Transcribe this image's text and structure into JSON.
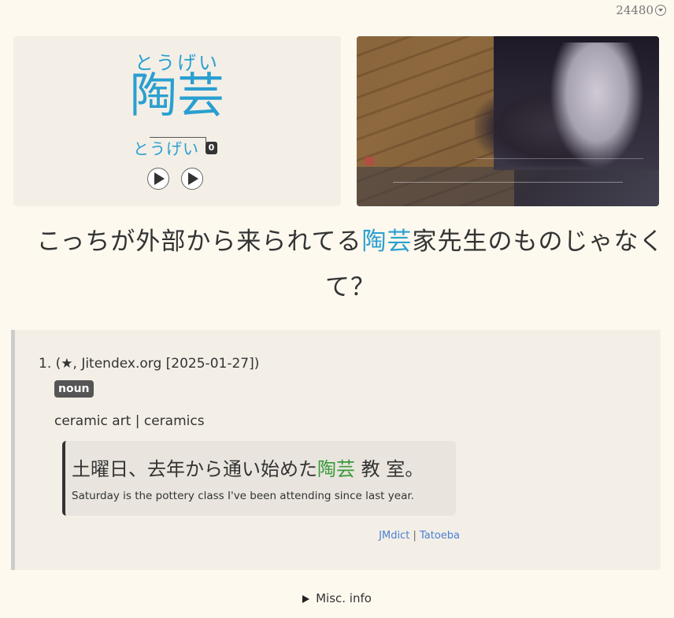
{
  "header": {
    "card_id": "24480",
    "menu_icon": "chevron-down-circle-icon"
  },
  "word": {
    "reading": "とうげい",
    "expression": "陶芸",
    "pitch_reading": "とうげい",
    "pitch_number": "0",
    "audio_buttons": [
      "play-icon",
      "play-icon"
    ]
  },
  "sentence": {
    "before": "こっちが外部から来られてる",
    "highlight": "陶芸",
    "after": "家先生のものじゃなくて？"
  },
  "definition": {
    "number": "1.",
    "source": "(★, Jitendex.org [2025-01-27])",
    "pos": "noun",
    "gloss": "ceramic art | ceramics",
    "example": {
      "jp_before": "土曜日、去年から通い始めた",
      "jp_highlight": "陶芸",
      "jp_after": " 教 室。",
      "en": "Saturday is the pottery class I've been attending since last year."
    },
    "sources": {
      "link1": "JMdict",
      "sep": " | ",
      "link2": "Tatoeba"
    }
  },
  "misc": {
    "label": "Misc. info"
  },
  "colors": {
    "accent_blue": "#2a9fd0",
    "example_green": "#3a9a3a",
    "background": "#fdf9ef"
  }
}
